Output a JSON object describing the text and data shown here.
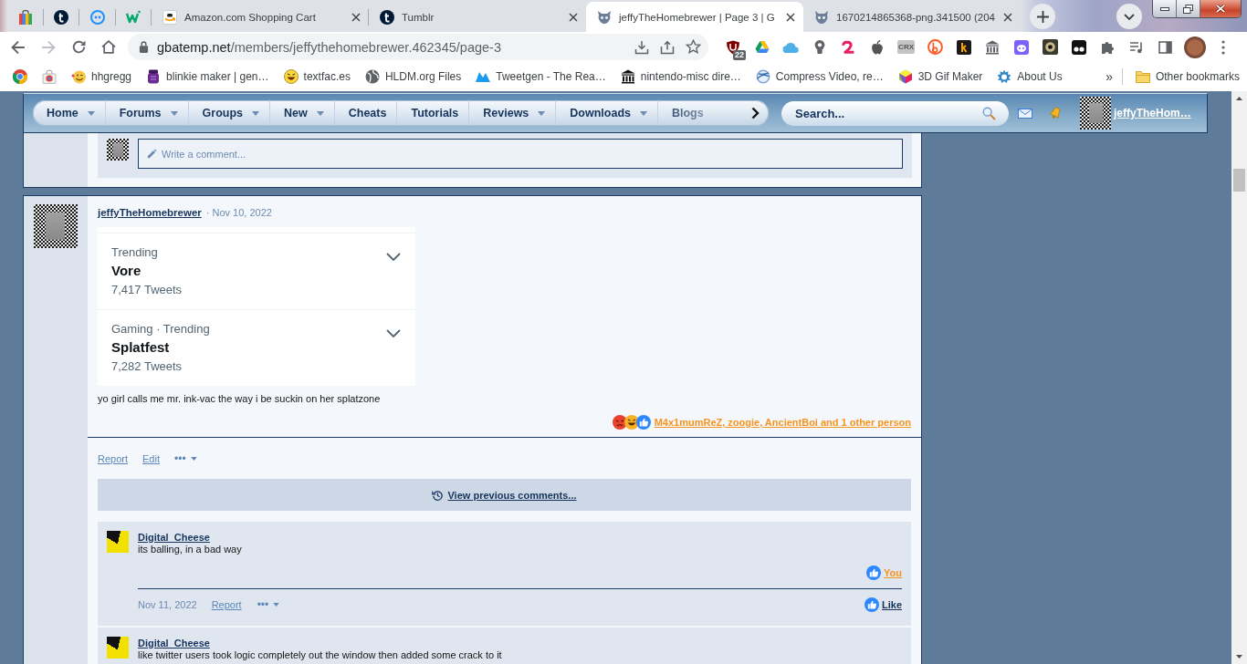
{
  "browser": {
    "tabs": [
      {
        "kind": "pinned",
        "selected": false
      },
      {
        "kind": "pinned",
        "selected": false
      },
      {
        "kind": "pinned",
        "selected": false
      },
      {
        "kind": "pinned",
        "selected": false
      },
      {
        "kind": "normal",
        "title": "Amazon.com Shopping Cart",
        "selected": false
      },
      {
        "kind": "normal",
        "title": "Tumblr",
        "selected": false
      },
      {
        "kind": "normal",
        "title": "jeffyTheHomebrewer | Page 3 | G",
        "selected": true
      },
      {
        "kind": "normal",
        "title": "1670214865368-png.341500 (204",
        "selected": false
      }
    ],
    "address": {
      "host": "gbatemp.net",
      "path": "/members/jeffythehomebrewer.462345/page-3"
    },
    "extension_badge": "22",
    "extension_label": "CRX",
    "bookmarks": [
      {
        "kind": "icon"
      },
      {
        "kind": "icon"
      },
      {
        "kind": "link",
        "title": "hhgregg"
      },
      {
        "kind": "link",
        "title": "blinkie maker | gen…"
      },
      {
        "kind": "link",
        "title": "textfac.es"
      },
      {
        "kind": "link",
        "title": "HLDM.org Files"
      },
      {
        "kind": "link",
        "title": "Tweetgen - The Rea…"
      },
      {
        "kind": "link",
        "title": "nintendo-misc dire…"
      },
      {
        "kind": "link",
        "title": "Compress Video, re…"
      },
      {
        "kind": "link",
        "title": "3D Gif Maker"
      },
      {
        "kind": "link",
        "title": "About Us"
      }
    ],
    "bookmarks_overflow": "»",
    "other_bookmarks": "Other bookmarks"
  },
  "site": {
    "nav": [
      {
        "label": "Home",
        "dropdown": true
      },
      {
        "label": "Forums",
        "dropdown": true
      },
      {
        "label": "Groups",
        "dropdown": true
      },
      {
        "label": "New",
        "dropdown": true
      },
      {
        "label": "Cheats",
        "dropdown": false
      },
      {
        "label": "Tutorials",
        "dropdown": false
      },
      {
        "label": "Reviews",
        "dropdown": true
      },
      {
        "label": "Downloads",
        "dropdown": true
      },
      {
        "label": "Blogs",
        "dropdown": false
      }
    ],
    "search": {
      "placeholder": "Search..."
    },
    "user": {
      "name": "jeffyTheHom…"
    }
  },
  "previous_post": {
    "comment_field": {
      "placeholder": "Write a comment..."
    }
  },
  "post": {
    "author": "jeffyTheHomebrewer",
    "date": "· Nov 10, 2022",
    "embed": {
      "trends": [
        {
          "context": "Trending",
          "topic": "Vore",
          "count": "7,417 Tweets"
        },
        {
          "context": "Gaming · Trending",
          "topic": "Splatfest",
          "count": "7,282 Tweets"
        }
      ]
    },
    "body": "yo girl calls me mr. ink-vac the way i be suckin on her splatzone",
    "reactions": "M4x1mumReZ, zoogie, AncientBoi and 1 other person",
    "actions": [
      "Report",
      "Edit"
    ],
    "more": "•••"
  },
  "view_previous": "View previous comments...",
  "comments": [
    {
      "author": "Digital_Cheese",
      "text": "its balling, in a bad way",
      "reaction": "You",
      "date": "Nov 11, 2022",
      "actions": [
        "Report"
      ],
      "more": "•••",
      "like": "Like"
    },
    {
      "author": "Digital_Cheese",
      "text": "like twitter users took logic completely out the window then added some crack to it"
    }
  ]
}
